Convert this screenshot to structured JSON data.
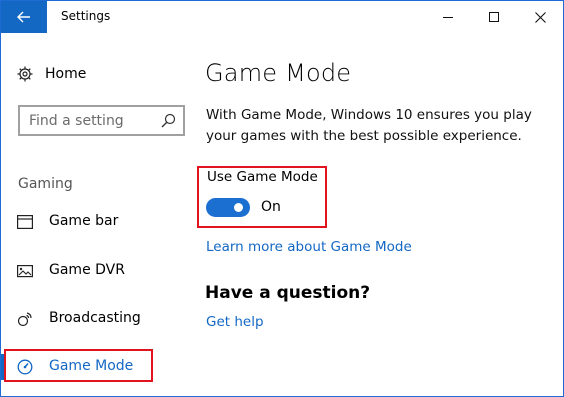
{
  "window": {
    "title": "Settings"
  },
  "sidebar": {
    "home_label": "Home",
    "search_placeholder": "Find a setting",
    "section_label": "Gaming",
    "items": [
      {
        "label": "Game bar",
        "icon": "game-bar-icon"
      },
      {
        "label": "Game DVR",
        "icon": "game-dvr-icon"
      },
      {
        "label": "Broadcasting",
        "icon": "broadcasting-icon"
      },
      {
        "label": "Game Mode",
        "icon": "game-mode-icon",
        "active": true
      }
    ]
  },
  "main": {
    "title": "Game Mode",
    "description": "With Game Mode, Windows 10 ensures you play your games with the best possible experience.",
    "toggle": {
      "label": "Use Game Mode",
      "state": "On",
      "on": true
    },
    "learn_more": "Learn more about Game Mode",
    "question_heading": "Have a question?",
    "help_link": "Get help"
  },
  "colors": {
    "accent": "#1368c4",
    "highlight": "#e0131f"
  }
}
